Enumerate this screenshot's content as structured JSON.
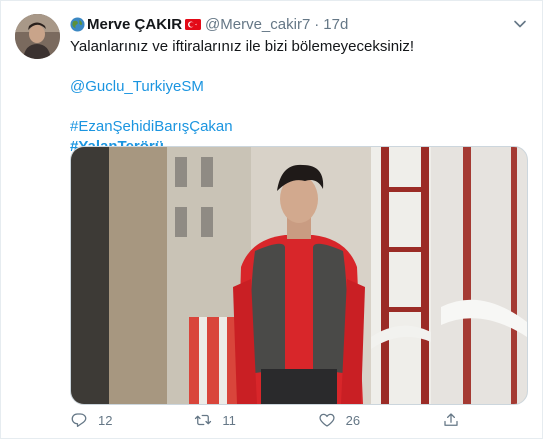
{
  "tweet": {
    "author": {
      "display_name": "Merve ÇAKIR",
      "handle": "@Merve_cakir7",
      "globe_icon": "globe-emoji-icon",
      "flag_icon": "turkey-flag-emoji-icon"
    },
    "separator": "·",
    "timestamp": "17d",
    "text": {
      "line1": "Yalanlarınız ve iftiralarınız ile bizi bölemeyeceksiniz!",
      "mention": "@Guclu_TurkiyeSM",
      "hashtag1": "#EzanŞehidiBarışÇakan",
      "hashtag2": "#YalanTerörü"
    },
    "actions": {
      "reply_count": "12",
      "retweet_count": "11",
      "like_count": "26"
    },
    "colors": {
      "link": "#1b95e0",
      "secondary_text": "#657786",
      "border": "#e6ecf0"
    }
  }
}
